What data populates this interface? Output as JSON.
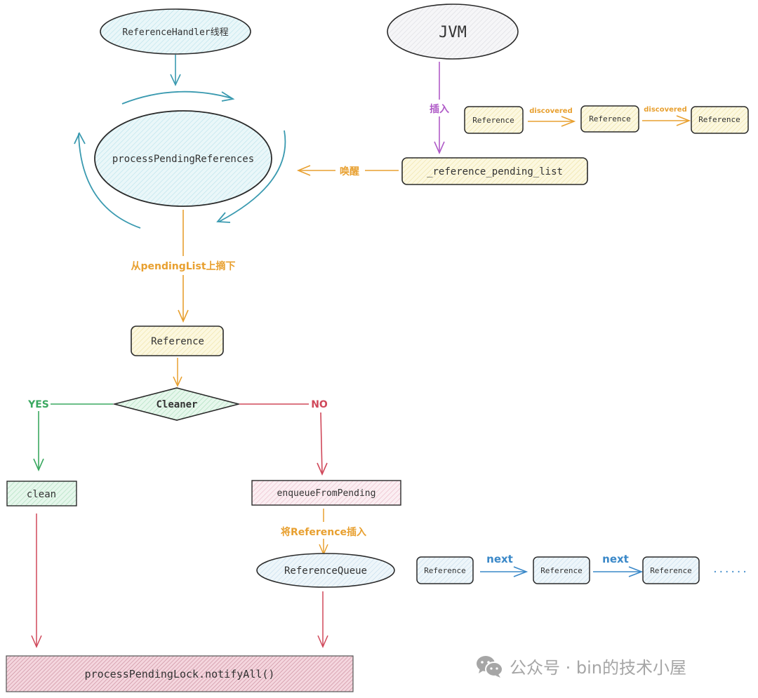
{
  "diagram": {
    "colors": {
      "teal": "#3a9ab0",
      "orange": "#e8a030",
      "purple": "#b05cc8",
      "green": "#3aa860",
      "red": "#d0485a",
      "blue": "#3a88c8",
      "stroke": "#2a2a2a",
      "fill_teal": "#e4f6f8",
      "fill_gray": "#f1f1f3",
      "fill_yellow": "#fbf6d8",
      "fill_green": "#dcf3e4",
      "fill_pink": "#f8e4ec",
      "fill_blue": "#e6f2f8"
    },
    "nodes": {
      "ref_handler": "ReferenceHandler线程",
      "jvm": "JVM",
      "process_pending": "processPendingReferences",
      "pending_list": "_reference_pending_list",
      "discovered_refs": [
        "Reference",
        "Reference",
        "Reference"
      ],
      "reference": "Reference",
      "cleaner": "Cleaner",
      "clean": "clean",
      "enqueue": "enqueueFromPending",
      "ref_queue": "ReferenceQueue",
      "queue_refs": [
        "Reference",
        "Reference",
        "Reference"
      ],
      "ellipsis": "......",
      "notify_all": "processPendingLock.notifyAll()"
    },
    "edges": {
      "insert": "插入",
      "discovered": [
        "discovered",
        "discovered"
      ],
      "wakeup": "唤醒",
      "take_from_pending": "从pendingList上摘下",
      "yes": "YES",
      "no": "NO",
      "insert_reference": "将Reference插入",
      "next": [
        "next",
        "next"
      ]
    }
  },
  "watermark": {
    "icon": "wechat-icon",
    "text": "公众号 · bin的技术小屋"
  }
}
